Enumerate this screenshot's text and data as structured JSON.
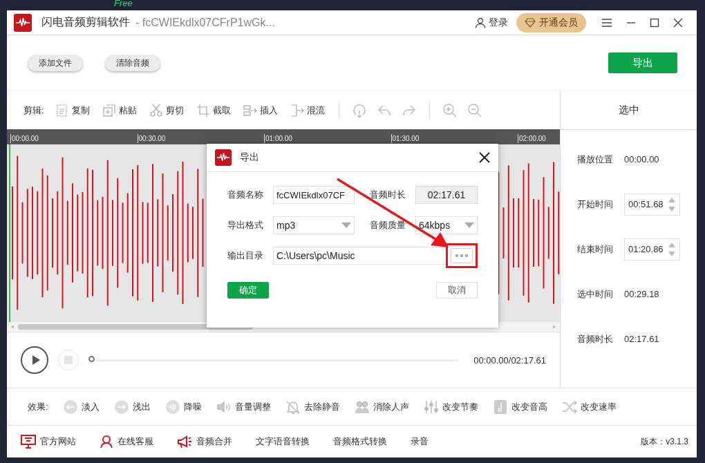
{
  "desktop": {
    "caption": "Free"
  },
  "window": {
    "title": "闪电音频剪辑软件",
    "file_name": "- fcCWIEkdlx07CFrP1wGk...",
    "login": "登录",
    "vip_button": "开通会员"
  },
  "top_buttons": [
    "添加文件",
    "清除音频"
  ],
  "export_button": "导出",
  "toolbar": {
    "label": "剪辑:",
    "tools": [
      "复制",
      "粘贴",
      "剪切",
      "截取",
      "插入",
      "混流"
    ]
  },
  "timeline": {
    "ticks": [
      "00:00.00",
      "00:30.00",
      "01:00.00",
      "01:30.00",
      "02:00.00"
    ]
  },
  "player": {
    "stop_disabled": true,
    "level": 0,
    "time": "00:00.00/02:17.61"
  },
  "selection_panel": {
    "title": "选中",
    "rows": [
      {
        "label": "播放位置",
        "value": "00:00.00",
        "kind": "text"
      },
      {
        "label": "开始时间",
        "value": "00:51.68",
        "kind": "spin"
      },
      {
        "label": "结束时间",
        "value": "01:20.86",
        "kind": "spin"
      },
      {
        "label": "选中时间",
        "value": "00:29.18",
        "kind": "text"
      },
      {
        "label": "音频时长",
        "value": "02:17.61",
        "kind": "text"
      }
    ]
  },
  "effects": {
    "label": "效果:",
    "items": [
      "淡入",
      "浅出",
      "降噪",
      "音量调整",
      "去除静音",
      "消除人声",
      "改变节奏",
      "改变音高",
      "改变速率"
    ]
  },
  "footer": {
    "links": [
      "官方网站",
      "在线客服",
      "音频合并",
      "文字语音转换",
      "音频格式转换",
      "录音"
    ],
    "version": "版本：v3.1.3"
  },
  "dialog": {
    "title": "导出",
    "name": {
      "label": "音频名称",
      "value": "fcCWIEkdlx07CF"
    },
    "duration": {
      "label": "音频时长",
      "value": "02:17.61"
    },
    "format": {
      "label": "导出格式",
      "value": "mp3"
    },
    "quality": {
      "label": "音频质量",
      "value": "64kbps"
    },
    "output_dir": {
      "label": "输出目录",
      "value": "C:\\Users\\pc\\Music"
    },
    "confirm": "确定",
    "cancel": "取消"
  }
}
